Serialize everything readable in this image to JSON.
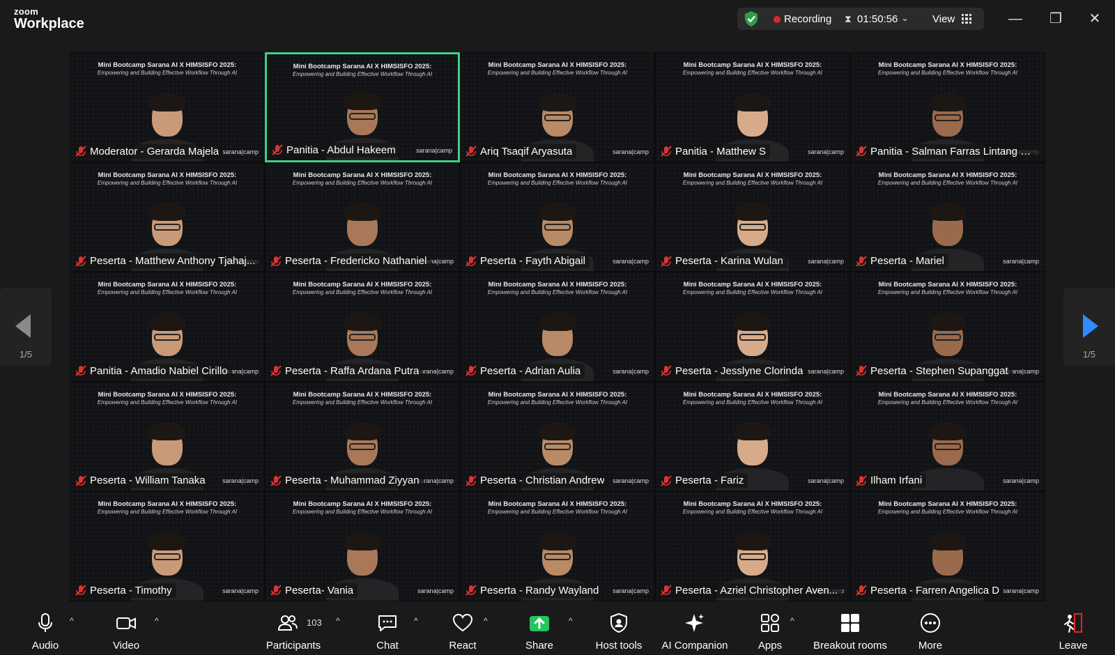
{
  "app": {
    "brand_small": "zoom",
    "brand_large": "Workplace"
  },
  "status": {
    "recording_label": "Recording",
    "timer": "01:50:56",
    "view_label": "View"
  },
  "slide": {
    "title": "Mini Bootcamp Sarana AI X HIMSISFO 2025:",
    "subtitle": "Empowering and Building Effective Workflow Through AI",
    "brand_tag": "sarana|camp"
  },
  "participants": [
    {
      "name": "Moderator - Gerarda Majela"
    },
    {
      "name": "Panitia - Abdul Hakeem"
    },
    {
      "name": "Ariq Tsaqif Aryasuta"
    },
    {
      "name": "Panitia - Matthew S"
    },
    {
      "name": "Panitia - Salman Farras Lintang H..."
    },
    {
      "name": "Peserta - Matthew Anthony Tjahaj..."
    },
    {
      "name": "Peserta - Fredericko Nathaniel"
    },
    {
      "name": "Peserta - Fayth Abigail"
    },
    {
      "name": "Peserta - Karina Wulan"
    },
    {
      "name": "Peserta - Mariel"
    },
    {
      "name": "Panitia - Amadio Nabiel Cirillo"
    },
    {
      "name": "Peserta - Raffa Ardana Putra"
    },
    {
      "name": "Peserta - Adrian Aulia"
    },
    {
      "name": "Peserta - Jesslyne Clorinda"
    },
    {
      "name": "Peserta - Stephen Supanggat"
    },
    {
      "name": "Peserta - William Tanaka"
    },
    {
      "name": "Peserta - Muhammad Ziyyan"
    },
    {
      "name": "Peserta - Christian Andrew"
    },
    {
      "name": "Peserta - Fariz"
    },
    {
      "name": "Ilham Irfani"
    },
    {
      "name": "Peserta - Timothy"
    },
    {
      "name": "Peserta- Vania"
    },
    {
      "name": "Peserta - Randy Wayland"
    },
    {
      "name": "Peserta - Azriel Christopher Aven..."
    },
    {
      "name": "Peserta - Farren Angelica D"
    }
  ],
  "paging": {
    "left": "1/5",
    "right": "1/5"
  },
  "toolbar": {
    "audio": "Audio",
    "video": "Video",
    "participants": "Participants",
    "participants_count": "103",
    "chat": "Chat",
    "react": "React",
    "share": "Share",
    "host_tools": "Host tools",
    "ai_companion": "AI Companion",
    "apps": "Apps",
    "breakout_rooms": "Breakout rooms",
    "more": "More",
    "leave": "Leave"
  },
  "colors": {
    "active_speaker": "#3fd28a",
    "share_green": "#22c55e",
    "recording_red": "#e02828",
    "next_arrow": "#2d8cff"
  }
}
